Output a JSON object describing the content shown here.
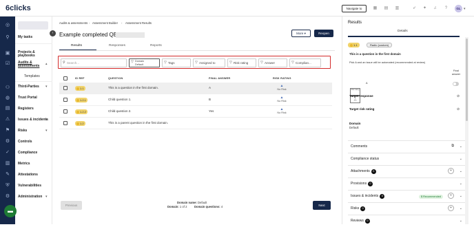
{
  "app": {
    "logo": "6clicks",
    "navigate_label": "Navigate to",
    "avatar": "GL"
  },
  "sidebar": {
    "items": [
      {
        "label": "My tasks"
      },
      {
        "label": "Projects & playbooks"
      },
      {
        "label": "Audits & assessments"
      },
      {
        "label": "Templates"
      },
      {
        "label": "Third-Parties"
      },
      {
        "label": "Trust Portal"
      },
      {
        "label": "Registers"
      },
      {
        "label": "Issues & incidents"
      },
      {
        "label": "Risks"
      },
      {
        "label": "Controls"
      },
      {
        "label": "Compliance"
      },
      {
        "label": "Metrics"
      },
      {
        "label": "Attestations"
      },
      {
        "label": "Vulnerabilities"
      },
      {
        "label": "Administration"
      }
    ]
  },
  "breadcrumb": [
    "Audits & assessments",
    "Assessment Builder",
    "Assessment Results"
  ],
  "page": {
    "title": "Example completed QBA",
    "more_label": "More",
    "reopen_label": "Reopen"
  },
  "tabs": [
    "Results",
    "Responses",
    "Reports"
  ],
  "filters": {
    "search_placeholder": "Search...",
    "domain_label": "Domain",
    "domain_value": "Default",
    "tags": "Tags",
    "assigned": "Assigned to",
    "risk": "Risk rating",
    "answer": "Answer",
    "compliance": "Complian..."
  },
  "table": {
    "headers": [
      "ID REF",
      "QUESTION",
      "FINAL ANSWER",
      "RISK RATING"
    ],
    "rows": [
      {
        "id": "1.1",
        "question": "This is a question in the first domain.",
        "answer": "A",
        "risk": "No Risk"
      },
      {
        "id": "1.2.1",
        "question": "Child question 1.",
        "answer": "B",
        "risk": "No Risk"
      },
      {
        "id": "1.2.2",
        "question": "Child question 2.",
        "answer": "Yes",
        "risk": "No Risk"
      },
      {
        "id": "1.2",
        "question": "This is a parent question in the first domain.",
        "answer": "",
        "risk": ""
      }
    ]
  },
  "pager": {
    "prev": "Previous",
    "next": "Next",
    "domain_name_label": "Domain name:",
    "domain_name_value": "Default",
    "domain_label": "Domain:",
    "domain_value": "1 of 2",
    "questions_label": "Domain questions:",
    "questions_value": "4"
  },
  "panel": {
    "title": "Results",
    "tab": "Details",
    "badge": "1.1",
    "radio": "Radio (custom)",
    "question": "This is a question in the first domain",
    "instruction": "Pick A and an issue will be automated (recommended at review)",
    "final_answer": "Final answer",
    "risk_label": "Risk rating",
    "option_a": "A",
    "target_response": "Target response",
    "target_risk": "Target risk rating",
    "domain_label": "Domain",
    "domain_value": "Default",
    "sections": [
      {
        "label": "Comments",
        "count": ""
      },
      {
        "label": "Compliance status",
        "count": ""
      },
      {
        "label": "Attachments",
        "count": "0"
      },
      {
        "label": "Provisions",
        "count": "0"
      },
      {
        "label": "Issues & incidents",
        "count": "0"
      },
      {
        "label": "Risks",
        "count": "0"
      },
      {
        "label": "Reviews",
        "count": "0"
      }
    ],
    "recommended": "Recommended"
  }
}
